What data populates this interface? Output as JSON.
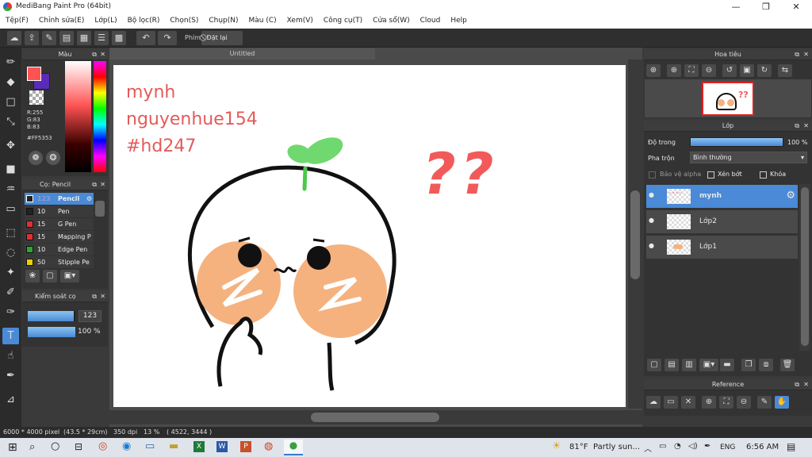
{
  "window": {
    "title": "MediBang Paint Pro (64bit)",
    "minimize": "—",
    "maximize": "❐",
    "close": "✕"
  },
  "menu": [
    "Tệp(F)",
    "Chỉnh sửa(E)",
    "Lớp(L)",
    "Bộ lọc(R)",
    "Chọn(S)",
    "Chụp(N)",
    "Màu (C)",
    "Xem(V)",
    "Công cụ(T)",
    "Cửa sổ(W)",
    "Cloud",
    "Help"
  ],
  "toolbar": {
    "phim_label": "Phím",
    "reset_label": "Đặt lại"
  },
  "color_panel": {
    "title": "Màu",
    "r": "R:255",
    "g": "G:83",
    "b": "B:83",
    "hex": "#FF5353",
    "primary_color": "#ff5353",
    "secondary_color": "#5a2bb8"
  },
  "brush_panel": {
    "title": "Cọ: Pencil",
    "brushes": [
      {
        "size": "123",
        "name": "Pencil",
        "color": "#222222"
      },
      {
        "size": "10",
        "name": "Pen",
        "color": "#222222"
      },
      {
        "size": "15",
        "name": "G Pen",
        "color": "#e03030"
      },
      {
        "size": "15",
        "name": "Mapping P",
        "color": "#e03030"
      },
      {
        "size": "10",
        "name": "Edge Pen",
        "color": "#2aa82a"
      },
      {
        "size": "50",
        "name": "Stipple Pe",
        "color": "#e8d000"
      }
    ]
  },
  "brush_control": {
    "title": "Kiểm soát cọ",
    "size_value": "123",
    "opacity_value": "100 %",
    "size_fill": 0.97,
    "opacity_fill": 1.0
  },
  "document": {
    "tab_title": "Untitled",
    "text_lines": [
      "mynh",
      "nguyenhue154",
      "#hd247"
    ],
    "question_marks": "??"
  },
  "navigator": {
    "title": "Hoa tiêu"
  },
  "layer_panel": {
    "title": "Lớp",
    "opacity_label": "Độ trong",
    "opacity_value": "100 %",
    "blend_label": "Pha trộn",
    "blend_value": "Bình thường",
    "protect_alpha": "Bảo vệ alpha",
    "clipping": "Xén bớt",
    "lock": "Khóa",
    "layers": [
      {
        "name": "mynh",
        "selected": true
      },
      {
        "name": "Lớp2",
        "selected": false
      },
      {
        "name": "Lớp1",
        "selected": false
      }
    ]
  },
  "reference_panel": {
    "title": "Reference"
  },
  "status": {
    "size": "6000 * 4000 pixel",
    "physical": "(43.5 * 29cm)",
    "dpi": "350 dpi",
    "zoom": "13 %",
    "coords": "( 4522, 3444 )"
  },
  "taskbar": {
    "temperature": "81°F",
    "weather": "Partly sun...",
    "lang": "ENG",
    "time": "6:56 AM"
  }
}
